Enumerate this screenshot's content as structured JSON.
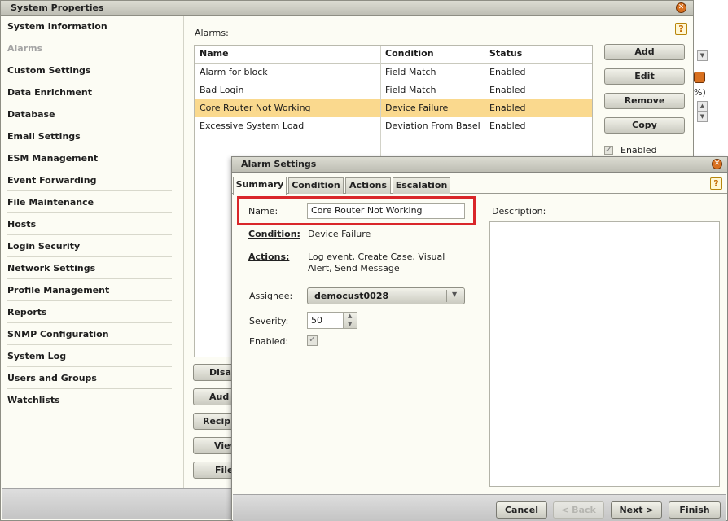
{
  "main_window": {
    "title": "System Properties",
    "close_glyph": "✕",
    "help_glyph": "?"
  },
  "sidebar": {
    "items": [
      {
        "label": "System Information"
      },
      {
        "label": "Alarms"
      },
      {
        "label": "Custom Settings"
      },
      {
        "label": "Data Enrichment"
      },
      {
        "label": "Database"
      },
      {
        "label": "Email Settings"
      },
      {
        "label": "ESM Management"
      },
      {
        "label": "Event Forwarding"
      },
      {
        "label": "File Maintenance"
      },
      {
        "label": "Hosts"
      },
      {
        "label": "Login Security"
      },
      {
        "label": "Network Settings"
      },
      {
        "label": "Profile Management"
      },
      {
        "label": "Reports"
      },
      {
        "label": "SNMP Configuration"
      },
      {
        "label": "System Log"
      },
      {
        "label": "Users and Groups"
      },
      {
        "label": "Watchlists"
      }
    ],
    "selected_index": 1
  },
  "alarms_panel": {
    "label": "Alarms:",
    "columns": [
      "Name",
      "Condition",
      "Status"
    ],
    "rows": [
      {
        "name": "Alarm for block",
        "condition": "Field Match",
        "status": "Enabled"
      },
      {
        "name": "Bad Login",
        "condition": "Field Match",
        "status": "Enabled"
      },
      {
        "name": "Core Router Not Working",
        "condition": "Device Failure",
        "status": "Enabled"
      },
      {
        "name": "Excessive System Load",
        "condition": "Deviation From Basel",
        "status": "Enabled"
      }
    ],
    "selected_row": 2,
    "buttons": {
      "add": "Add",
      "edit": "Edit",
      "remove": "Remove",
      "copy": "Copy"
    },
    "enabled_label": "Enabled",
    "enabled_checked": true,
    "lower_buttons": [
      "Disab",
      "Aud",
      "Recipie",
      "View",
      "File"
    ],
    "cut_off_text": "%)"
  },
  "dialog": {
    "title": "Alarm Settings",
    "close_glyph": "✕",
    "help_glyph": "?",
    "tabs": [
      "Summary",
      "Condition",
      "Actions",
      "Escalation"
    ],
    "active_tab": 0,
    "fields": {
      "name_label": "Name:",
      "name_value": "Core Router Not Working",
      "condition_label": "Condition:",
      "condition_value": "Device Failure",
      "actions_label": "Actions:",
      "actions_value_line1": "Log event, Create Case, Visual",
      "actions_value_line2": "Alert, Send Message",
      "assignee_label": "Assignee:",
      "assignee_value": "democust0028",
      "severity_label": "Severity:",
      "severity_value": "50",
      "enabled_label": "Enabled:",
      "enabled_checked": true,
      "description_label": "Description:",
      "description_value": ""
    },
    "highlight_color": "#d9262a",
    "footer_buttons": {
      "cancel": "Cancel",
      "back": "< Back",
      "next": "Next >",
      "finish": "Finish"
    },
    "back_disabled": true
  }
}
